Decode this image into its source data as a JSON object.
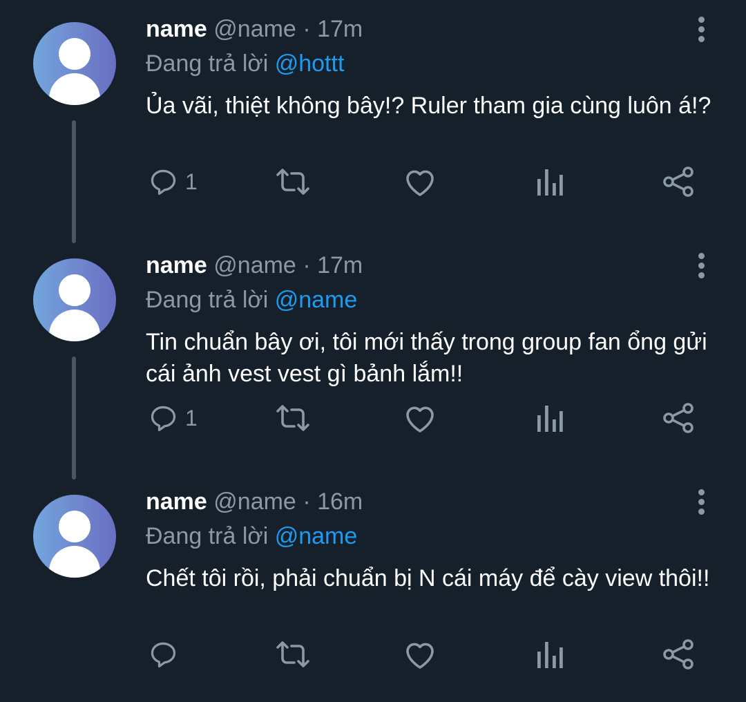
{
  "tweets": [
    {
      "name": "name",
      "handle": "@name",
      "separator": "·",
      "time": "17m",
      "replying_prefix": "Đang trả lời",
      "replying_to": "@hottt",
      "text": "Ủa vãi, thiệt không bây!? Ruler tham gia cùng luôn á!?",
      "reply_count": "1"
    },
    {
      "name": "name",
      "handle": "@name",
      "separator": "·",
      "time": "17m",
      "replying_prefix": "Đang trả lời",
      "replying_to": "@name",
      "text": "Tin chuẩn bây ơi, tôi mới thấy trong group fan ổng gửi cái ảnh vest vest gì bảnh lắm!!",
      "reply_count": "1"
    },
    {
      "name": "name",
      "handle": "@name",
      "separator": "·",
      "time": "16m",
      "replying_prefix": "Đang trả lời",
      "replying_to": "@name",
      "text": "Chết tôi rồi, phải chuẩn bị N cái máy để cày view thôi!!",
      "reply_count": ""
    }
  ],
  "icons": {
    "reply": "reply-icon",
    "retweet": "retweet-icon",
    "like": "like-icon",
    "views": "views-icon",
    "share": "share-icon",
    "more": "more-icon",
    "avatar": "default-avatar"
  },
  "colors": {
    "background": "#15202b",
    "text": "#ffffff",
    "secondary": "#8b98a5",
    "mention": "#1d9bf0",
    "thread_line": "#4a5562"
  }
}
